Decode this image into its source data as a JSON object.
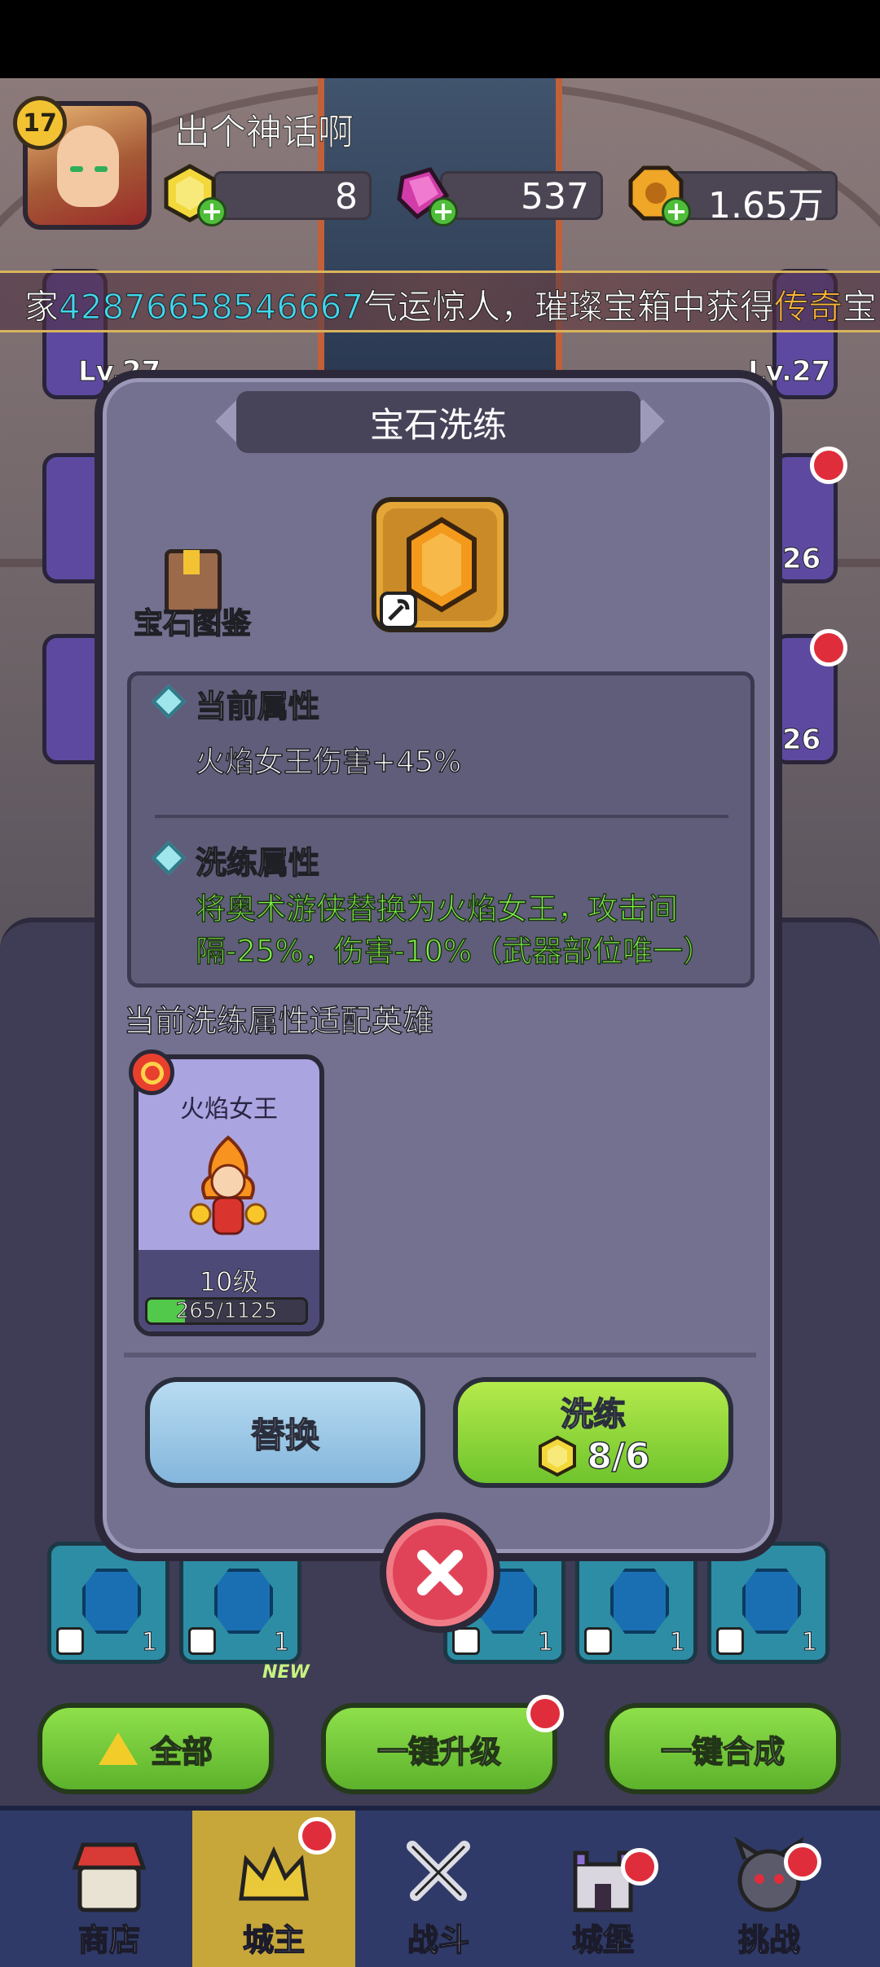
{
  "player": {
    "level": "17",
    "name": "出个神话啊",
    "gold_gem": "8",
    "crystal": "537",
    "coin": "1.65万"
  },
  "ticker": {
    "prefix": "家",
    "player_id": "42876658546667",
    "middle": "气运惊人，璀璨宝箱中获得",
    "highlight": "传奇",
    "suffix": "宝"
  },
  "side_slots": {
    "left_lv": "Lv.27",
    "right_lv": "Lv.27",
    "right_val_1": "26",
    "right_val_2": "26"
  },
  "modal": {
    "title": "宝石洗练",
    "codex_label": "宝石图鉴",
    "current_attr_title": "当前属性",
    "current_attr_text": "火焰女王伤害+45%",
    "refine_attr_title": "洗练属性",
    "refine_attr_text": "将奥术游侠替换为火焰女王，攻击间隔-25%，伤害-10%（武器部位唯一）",
    "adapt_label": "当前洗练属性适配英雄",
    "hero": {
      "name": "火焰女王",
      "level": "10级",
      "exp_text": "265/1125",
      "exp_ratio": 0.2356
    },
    "replace_label": "替换",
    "refine_label": "洗练",
    "refine_cost": "8/6"
  },
  "grid": {
    "tile_count": "1",
    "all_label": "全部",
    "upgrade_label": "一键升级",
    "merge_label": "一键合成",
    "new_tag": "NEW"
  },
  "nav": {
    "shop": "商店",
    "lord": "城主",
    "battle": "战斗",
    "castle": "城堡",
    "challenge": "挑战"
  },
  "colors": {
    "accent_green": "#80f24c",
    "ticker_id": "#41d7ef",
    "legendary": "#ffb43a",
    "red_dot": "#e02d3c"
  }
}
